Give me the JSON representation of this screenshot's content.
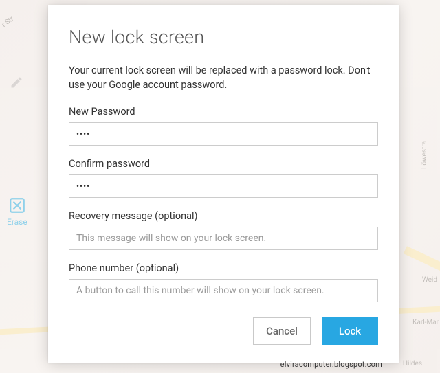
{
  "dialog": {
    "title": "New lock screen",
    "description": "Your current lock screen will be replaced with a password lock. Don't use your Google account password.",
    "fields": {
      "new_password": {
        "label": "New Password",
        "value": "••••"
      },
      "confirm_password": {
        "label": "Confirm password",
        "value": "••••"
      },
      "recovery_message": {
        "label": "Recovery message (optional)",
        "placeholder": "This message will show on your lock screen."
      },
      "phone_number": {
        "label": "Phone number (optional)",
        "placeholder": "A button to call this number will show on your lock screen."
      }
    },
    "buttons": {
      "cancel": "Cancel",
      "lock": "Lock"
    }
  },
  "sidebar": {
    "erase_label": "Erase"
  },
  "map": {
    "street1": "r Str.",
    "street2": "Löwestra",
    "street3": "Weid",
    "street4": "Karl-Mar",
    "street5": "Hildes"
  },
  "watermark": "elviracomputer.blogspot.com",
  "colors": {
    "accent": "#28a7e2",
    "erase": "#3bb6e6"
  }
}
